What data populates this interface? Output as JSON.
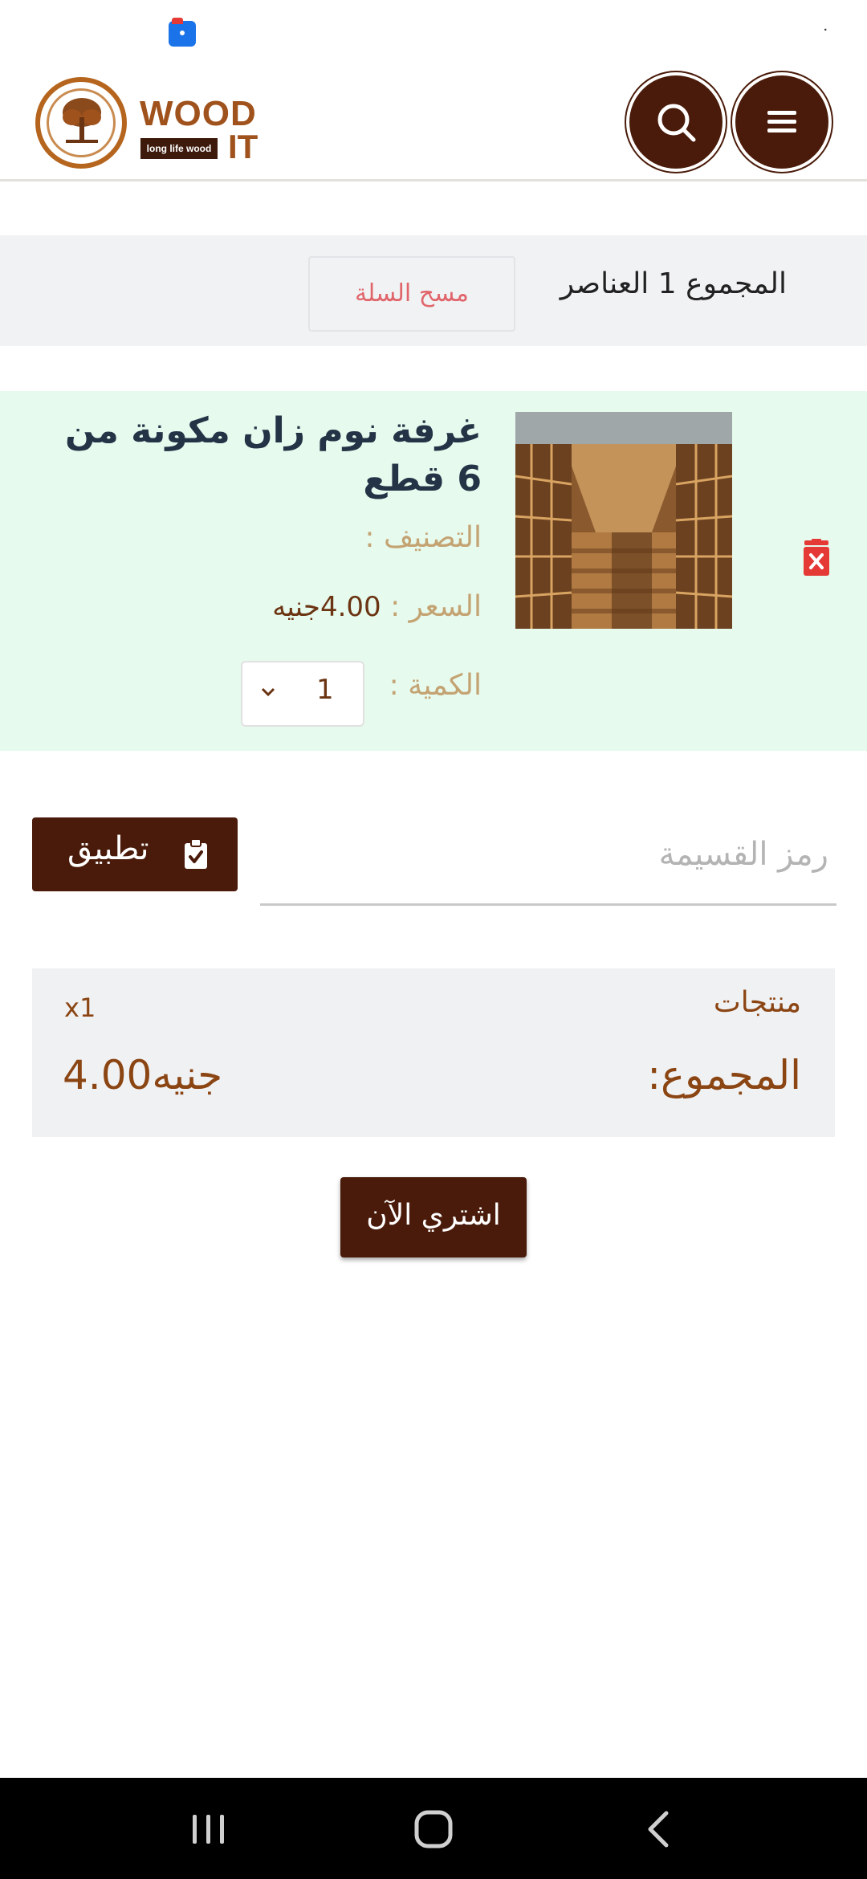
{
  "status_bar": {
    "app_icon": "files-app-icon",
    "signal_mark": "ׁ"
  },
  "header": {
    "logo": {
      "word": "WOOD",
      "tagline": "long life wood",
      "suffix": "IT",
      "icon": "tree-logo-icon"
    },
    "search_icon": "search-icon",
    "menu_icon": "hamburger-menu-icon"
  },
  "cart": {
    "count_text": "المجموع  1 العناصر",
    "clear_label": "مسح السلة"
  },
  "product": {
    "title": "غرفة نوم زان مكونة من 6 قطع",
    "category_label": "التصنيف :",
    "price_label": "السعر :",
    "price_value": "4.00جنيه",
    "quantity_label": "الكمية :",
    "quantity_value": "1",
    "delete_icon": "trash-icon",
    "image_icon": "bookshelf-library-photo"
  },
  "coupon": {
    "placeholder": "رمز القسيمة",
    "value": "",
    "apply_label": "تطبيق",
    "apply_icon": "clipboard-check-icon"
  },
  "totals": {
    "products_label": "منتجات",
    "count": "x1",
    "total_label": "المجموع:",
    "total_value": "4.00جنيه"
  },
  "buy_now_label": "اشتري الآن",
  "nav": {
    "recent": "recent-apps-icon",
    "home": "home-icon",
    "back": "back-icon"
  },
  "colors": {
    "brand_dark": "#4a1b0a",
    "brand_brown": "#a0521d",
    "card_bg": "#e6faed",
    "muted_gold": "#c4a373",
    "danger": "#e53935",
    "clear_text": "#e0666b"
  }
}
